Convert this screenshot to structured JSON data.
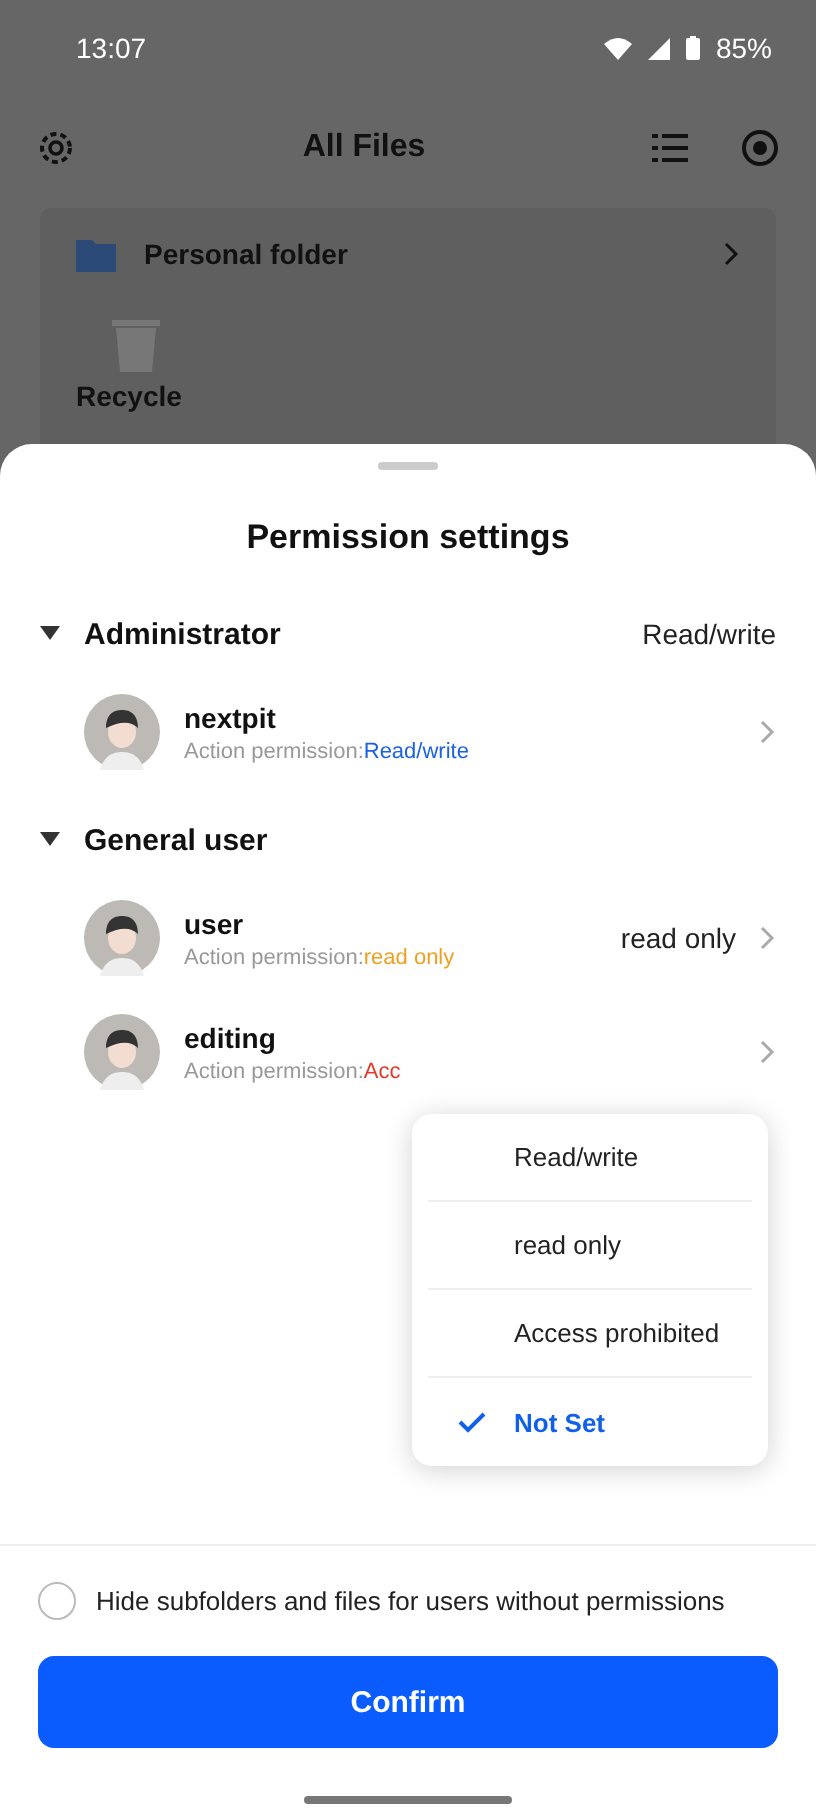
{
  "status_bar": {
    "time": "13:07",
    "battery": "85%"
  },
  "app_bar": {
    "title": "All Files"
  },
  "background": {
    "folder": "Personal folder",
    "recycle": "Recycle"
  },
  "sheet": {
    "title": "Permission settings",
    "groups": [
      {
        "name": "Administrator",
        "value": "Read/write",
        "expanded": true,
        "users": [
          {
            "name": "nextpit",
            "permission_prefix": "Action permission:",
            "permission": "Read/write",
            "kind": "read_write"
          }
        ]
      },
      {
        "name": "General user",
        "expanded": true,
        "users": [
          {
            "name": "user",
            "value": "read only",
            "permission_prefix": "Action permission:",
            "permission": "read only",
            "kind": "read_only"
          },
          {
            "name": "editing",
            "permission_prefix": "Action permission:",
            "permission": "Acc",
            "kind": "prohibited"
          }
        ]
      }
    ],
    "menu": [
      {
        "label": "Read/write",
        "selected": false
      },
      {
        "label": "read only",
        "selected": false
      },
      {
        "label": "Access prohibited",
        "selected": false
      },
      {
        "label": "Not Set",
        "selected": true
      }
    ],
    "hide_option": {
      "label": "Hide subfolders and files for users without permissions",
      "checked": false
    },
    "confirm": "Confirm"
  }
}
